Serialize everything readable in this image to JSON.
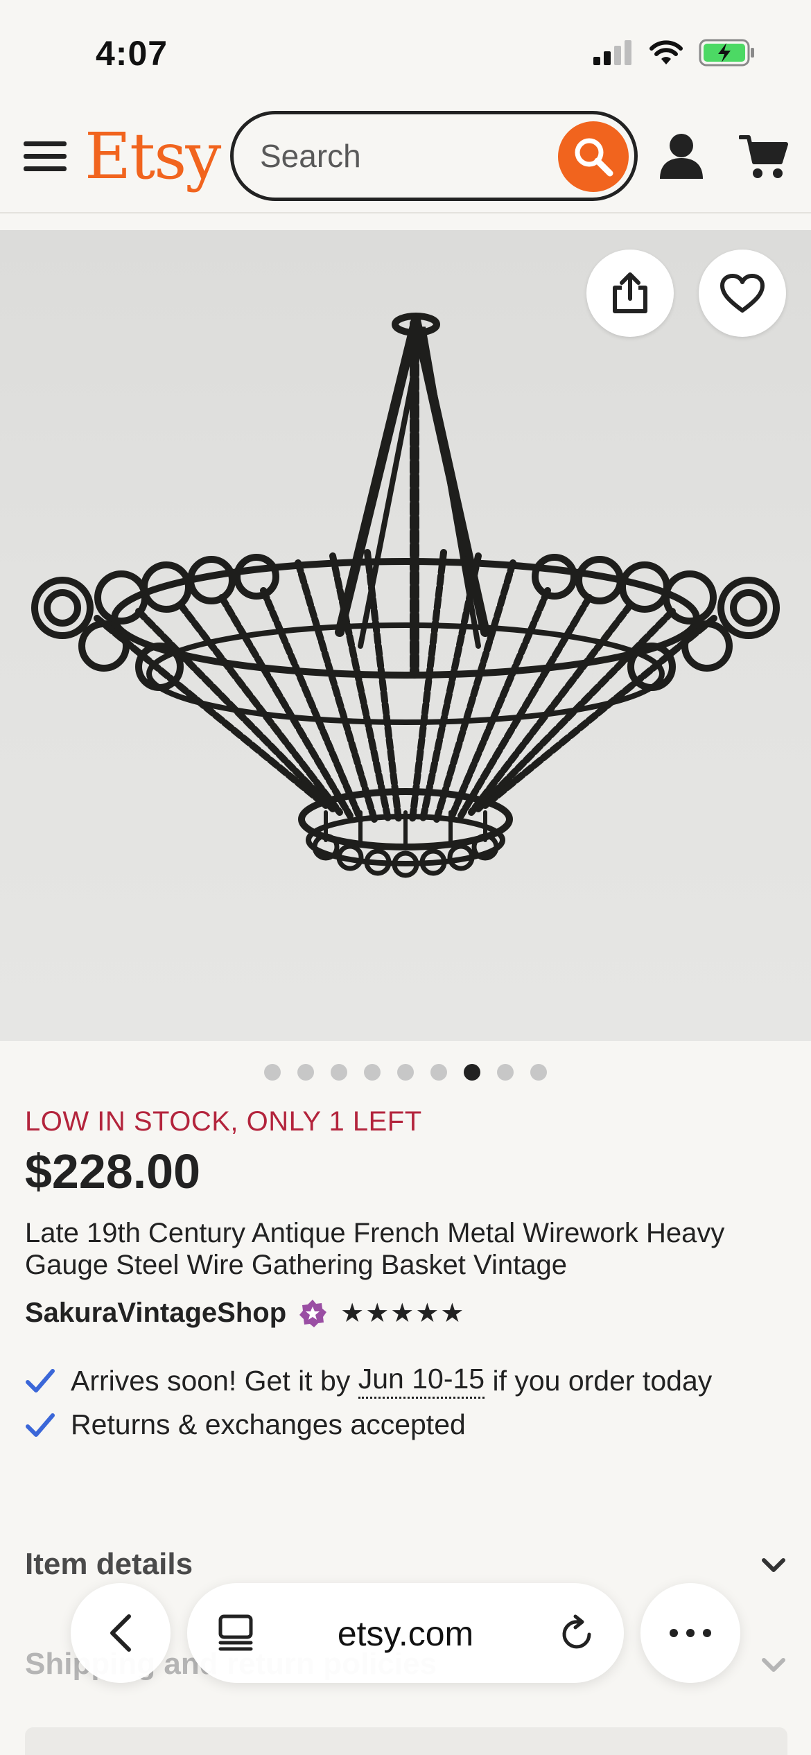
{
  "status_bar": {
    "time": "4:07"
  },
  "header": {
    "logo": "Etsy",
    "search": {
      "placeholder": "Search",
      "value": ""
    }
  },
  "listing": {
    "image_index": 7,
    "image_count": 9,
    "stock_message": "LOW IN STOCK, ONLY 1 LEFT",
    "price": "$228.00",
    "title": "Late 19th Century Antique French Metal Wirework Heavy Gauge Steel Wire Gathering Basket Vintage",
    "shop_name": "SakuraVintageShop",
    "rating_stars": "★★★★★",
    "rating": 5,
    "benefits": {
      "delivery_prefix": "Arrives soon! Get it by ",
      "delivery_date": "Jun 10-15",
      "delivery_suffix": " if you order today",
      "returns": "Returns & exchanges accepted"
    }
  },
  "sections": {
    "item_details": "Item details",
    "shipping": "Shipping and return policies"
  },
  "browser": {
    "url": "etsy.com"
  },
  "colors": {
    "brand": "#f1641e",
    "stock_warning": "#b3243c",
    "check": "#3b67d8",
    "star_seller": "#9a4ea3"
  },
  "icons": [
    "menu-icon",
    "search-icon",
    "user-icon",
    "cart-icon",
    "share-icon",
    "heart-icon",
    "star-seller-icon",
    "check-icon",
    "chevron-down-icon",
    "back-icon",
    "tabs-icon",
    "reload-icon",
    "more-icon"
  ]
}
